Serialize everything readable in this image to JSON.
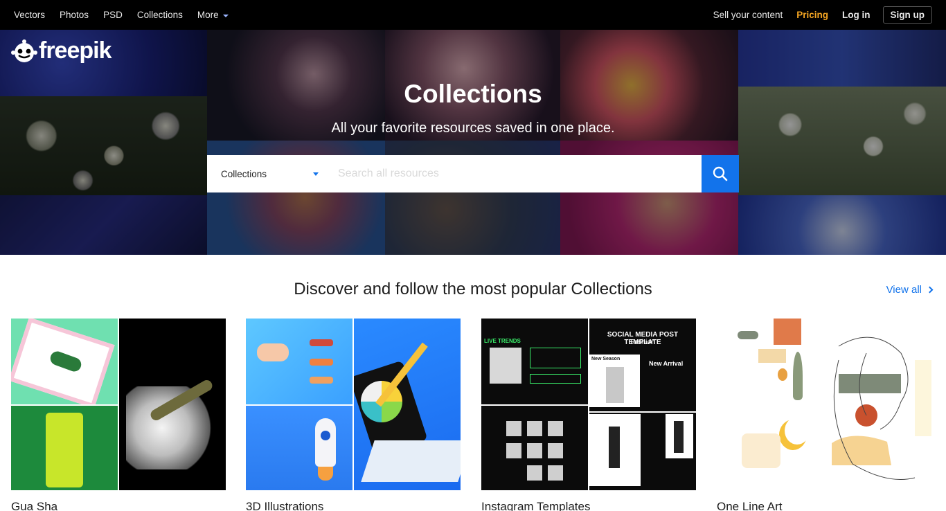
{
  "nav": {
    "left": [
      "Vectors",
      "Photos",
      "PSD",
      "Collections"
    ],
    "more_label": "More",
    "sell": "Sell your content",
    "pricing": "Pricing",
    "login": "Log in",
    "signup": "Sign up"
  },
  "hero": {
    "logo_text": "freepik",
    "title": "Collections",
    "subtitle": "All your favorite resources saved in one place.",
    "search_select": "Collections",
    "search_placeholder": "Search all resources"
  },
  "section": {
    "title": "Discover and follow the most popular Collections",
    "view_all": "View all"
  },
  "cards": [
    {
      "label": "Gua Sha"
    },
    {
      "label": "3D Illustrations"
    },
    {
      "label": "Instagram Templates"
    },
    {
      "label": "One Line Art"
    }
  ],
  "instagram_tile_text": {
    "title": "SOCIAL MEDIA POST TEMPLATE",
    "subtitle": "Fashion",
    "new_season": "New Season",
    "new_arrival": "New Arrival",
    "trends": "LIVE TRENDS"
  },
  "colors": {
    "accent": "#1273eb",
    "pricing": "#f5a623",
    "nav_bg": "#000000"
  }
}
